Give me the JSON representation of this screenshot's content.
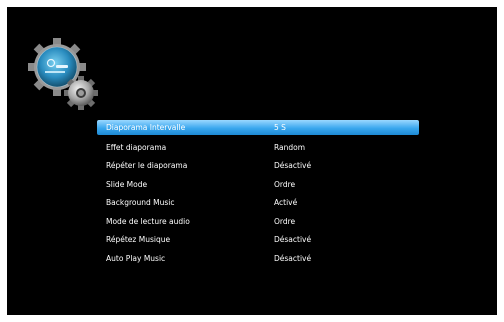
{
  "settings": {
    "items": [
      {
        "label": "Diaporama Intervalle",
        "value": "5 S"
      },
      {
        "label": "Effet diaporama",
        "value": "Random"
      },
      {
        "label": "Répéter le diaporama",
        "value": "Désactivé"
      },
      {
        "label": "Slide Mode",
        "value": "Ordre"
      },
      {
        "label": "Background Music",
        "value": "Activé"
      },
      {
        "label": "Mode de lecture audio",
        "value": "Ordre"
      },
      {
        "label": "Répétez Musique",
        "value": "Désactivé"
      },
      {
        "label": "Auto Play Music",
        "value": "Désactivé"
      }
    ]
  },
  "colors": {
    "screen_background": "#000000",
    "selection_highlight": "#3aa7ee",
    "text": "#ffffff"
  },
  "icons": {
    "logo": "settings-gear-icon"
  }
}
